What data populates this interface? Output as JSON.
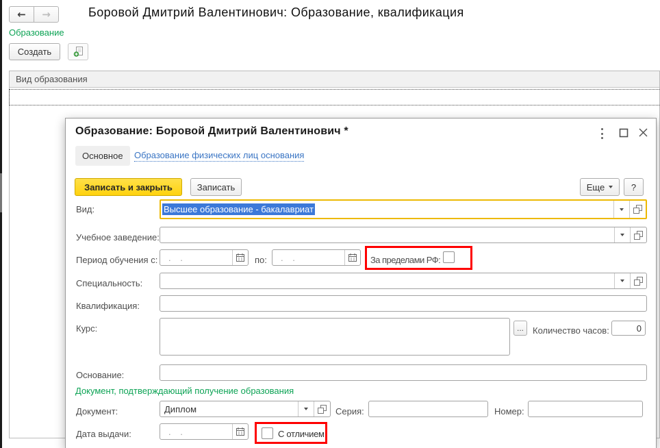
{
  "app": {
    "title": "Боровой Дмитрий Валентинович: Образование, квалификация",
    "section_link": "Образование",
    "toolbar": {
      "create": "Создать"
    },
    "table": {
      "header": "Вид образования"
    }
  },
  "dialog": {
    "title": "Образование: Боровой Дмитрий Валентинович *",
    "tabs": {
      "main": "Основное",
      "link": "Образование физических лиц основания"
    },
    "commands": {
      "save_close": "Записать и закрыть",
      "save": "Записать",
      "more": "Еще",
      "help": "?"
    },
    "fields": {
      "kind_label": "Вид:",
      "kind_value": "Высшее образование - бакалавриат",
      "institution_label": "Учебное заведение:",
      "period_label": "Период обучения с:",
      "period_to_label": "по:",
      "date_placeholder": ".  .",
      "outside_rf_label": "За пределами РФ:",
      "specialty_label": "Специальность:",
      "qualification_label": "Квалификация:",
      "course_label": "Курс:",
      "course_more": "...",
      "hours_label": "Количество часов:",
      "hours_value": "0",
      "basis_label": "Основание:",
      "doc_group_label": "Документ, подтверждающий получение образования",
      "document_label": "Документ:",
      "document_value": "Диплом",
      "series_label": "Серия:",
      "number_label": "Номер:",
      "issue_date_label": "Дата выдачи:",
      "honors_label": "С отличием"
    },
    "annotation_color": "#ff0000"
  }
}
